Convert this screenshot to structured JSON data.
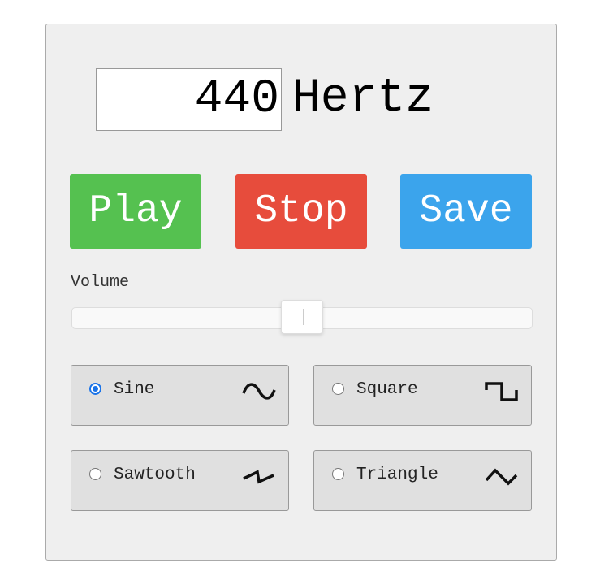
{
  "frequency": {
    "value": "440",
    "unit": "Hertz"
  },
  "buttons": {
    "play": "Play",
    "stop": "Stop",
    "save": "Save"
  },
  "colors": {
    "play": "#55c150",
    "stop": "#e74c3c",
    "save": "#3ba4ec",
    "radio": "#1a73e8"
  },
  "volume": {
    "label": "Volume",
    "value_percent": 50
  },
  "waveforms": [
    {
      "label": "Sine",
      "icon": "sine-wave-icon",
      "selected": true
    },
    {
      "label": "Square",
      "icon": "square-wave-icon",
      "selected": false
    },
    {
      "label": "Sawtooth",
      "icon": "sawtooth-wave-icon",
      "selected": false
    },
    {
      "label": "Triangle",
      "icon": "triangle-wave-icon",
      "selected": false
    }
  ]
}
